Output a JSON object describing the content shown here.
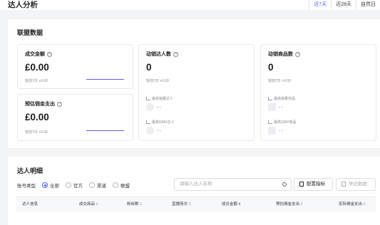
{
  "header": {
    "title": "达人分析",
    "tabs": [
      {
        "label": "近7天",
        "active": true
      },
      {
        "label": "近28天",
        "active": false
      },
      {
        "label": "自然日",
        "active": false
      }
    ]
  },
  "alliance": {
    "title": "联盟数据",
    "gmv": {
      "label": "成交金额",
      "value": "£0.00",
      "compare": "较前7日 +0.00"
    },
    "commission": {
      "label": "预估佣金支出",
      "value": "£0.00",
      "compare": "较前7日 +0.00"
    },
    "creators": {
      "label": "动销达人数",
      "value": "0",
      "compare": "较前7日 +0.00",
      "top_sales_title": "最高销量达人",
      "top_sales_value": "- -",
      "top_gmv_title": "最高GMV达人",
      "top_gmv_value": "- -"
    },
    "products": {
      "label": "动销商品数",
      "value": "0",
      "compare": "较前7日 +0.00",
      "top_sales_title": "最高销量商品",
      "top_sales_value": "- -",
      "top_gmv_title": "最高GMV商品",
      "top_gmv_value": "- -"
    }
  },
  "details": {
    "title": "达人明细",
    "filter_label": "账号类型",
    "filter_options": [
      {
        "label": "全部",
        "selected": true
      },
      {
        "label": "官方",
        "selected": false
      },
      {
        "label": "渠道",
        "selected": false
      },
      {
        "label": "联盟",
        "selected": false
      }
    ],
    "search_placeholder": "请输入达人名称",
    "config_button": "配置指标",
    "export_button": "导出数据",
    "columns": [
      {
        "label": "达人信息",
        "sortable": false
      },
      {
        "label": "成交商品",
        "sortable": true
      },
      {
        "label": "粉丝数",
        "sortable": true
      },
      {
        "label": "直播场次",
        "sortable": true
      },
      {
        "label": "成交金额",
        "sortable": true,
        "active": true
      },
      {
        "label": "预估佣金支出",
        "sortable": true
      },
      {
        "label": "实际佣金支出",
        "sortable": true
      }
    ]
  },
  "colors": {
    "accent": "#4a5fff",
    "spark": "#6a5bd6"
  }
}
